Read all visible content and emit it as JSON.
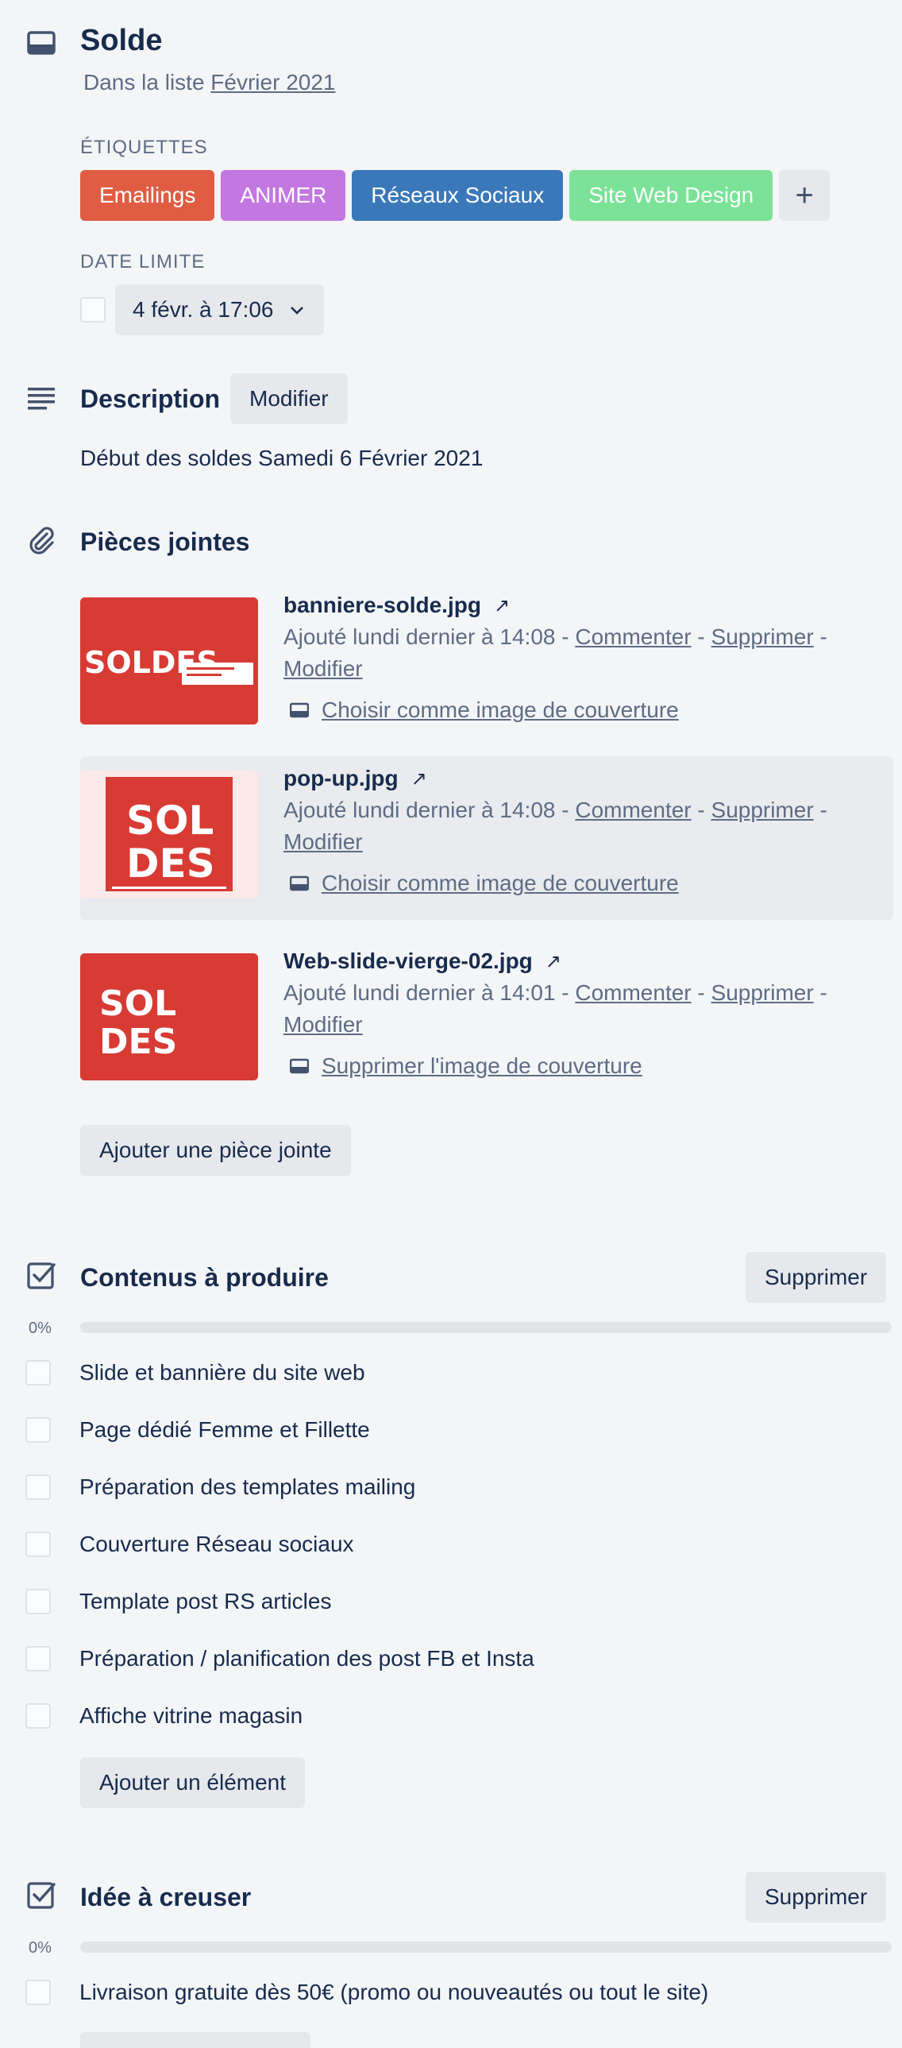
{
  "card": {
    "title": "Solde",
    "in_list_prefix": "Dans la liste",
    "list_name": "Février 2021"
  },
  "labels": {
    "heading": "ÉTIQUETTES",
    "items": [
      {
        "text": "Emailings",
        "color": "#e05d44"
      },
      {
        "text": "ANIMER",
        "color": "#c377e0"
      },
      {
        "text": "Réseaux Sociaux",
        "color": "#3a78b9"
      },
      {
        "text": "Site Web Design",
        "color": "#7be298"
      }
    ],
    "add_icon": "plus-icon"
  },
  "due": {
    "heading": "DATE LIMITE",
    "value": "4 févr. à 17:06"
  },
  "description": {
    "title": "Description",
    "edit_label": "Modifier",
    "text": "Début des soldes Samedi 6 Février 2021"
  },
  "attachments": {
    "title": "Pièces jointes",
    "items": [
      {
        "name": "banniere-solde.jpg",
        "meta_prefix": "Ajouté lundi dernier à 14:08 -",
        "comment": "Commenter",
        "delete": "Supprimer",
        "edit": "Modifier",
        "cover_action": "Choisir comme image de couverture"
      },
      {
        "name": "pop-up.jpg",
        "meta_prefix": "Ajouté lundi dernier à 14:08 -",
        "comment": "Commenter",
        "delete": "Supprimer",
        "edit": "Modifier",
        "cover_action": "Choisir comme image de couverture"
      },
      {
        "name": "Web-slide-vierge-02.jpg",
        "meta_prefix": "Ajouté lundi dernier à 14:01 -",
        "comment": "Commenter",
        "delete": "Supprimer",
        "edit": "Modifier",
        "cover_action": "Supprimer l'image de couverture"
      }
    ],
    "add_label": "Ajouter une pièce jointe"
  },
  "checklist1": {
    "title": "Contenus à produire",
    "delete_label": "Supprimer",
    "progress_text": "0%",
    "progress": 0,
    "items": [
      "Slide et bannière du site web",
      "Page dédié Femme et Fillette",
      "Préparation des templates mailing",
      "Couverture Réseau sociaux",
      "Template post RS articles",
      "Préparation / planification des post FB et Insta",
      "Affiche vitrine magasin"
    ],
    "add_label": "Ajouter un élément"
  },
  "checklist2": {
    "title": "Idée à creuser",
    "delete_label": "Supprimer",
    "progress_text": "0%",
    "progress": 0,
    "items": [
      "Livraison gratuite dès 50€ (promo ou nouveautés ou tout le site)"
    ]
  },
  "thumb_text": {
    "soldes": "SOLDES",
    "sol": "SOL",
    "des": "DES"
  }
}
